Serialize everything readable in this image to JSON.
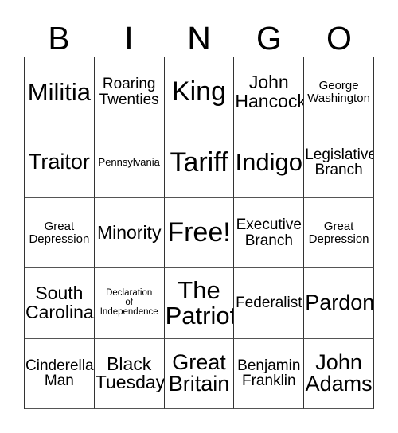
{
  "card": {
    "type": "bingo-card",
    "columns": 5,
    "rows": 5,
    "free_space": "Free!",
    "colors": {
      "background": "#ffffff",
      "text": "#000000",
      "grid_line": "#333333"
    }
  },
  "header": {
    "letters": [
      "B",
      "I",
      "N",
      "G",
      "O"
    ]
  },
  "grid": {
    "rows": [
      {
        "cells": [
          {
            "text": "Militia",
            "size": "xl"
          },
          {
            "text": "Roaring\nTwenties",
            "size": "sm"
          },
          {
            "text": "King",
            "size": "xxl"
          },
          {
            "text": "John\nHancock",
            "size": "md"
          },
          {
            "text": "George\nWashington",
            "size": "xs"
          }
        ]
      },
      {
        "cells": [
          {
            "text": "Traitor",
            "size": "lg"
          },
          {
            "text": "Pennsylvania",
            "size": "xxs"
          },
          {
            "text": "Tariff",
            "size": "xxl"
          },
          {
            "text": "Indigo",
            "size": "xl"
          },
          {
            "text": "Legislative\nBranch",
            "size": "sm"
          }
        ]
      },
      {
        "cells": [
          {
            "text": "Great\nDepression",
            "size": "xs"
          },
          {
            "text": "Minority",
            "size": "md"
          },
          {
            "text": "Free!",
            "size": "xxl"
          },
          {
            "text": "Executive\nBranch",
            "size": "sm"
          },
          {
            "text": "Great\nDepression",
            "size": "xs"
          }
        ]
      },
      {
        "cells": [
          {
            "text": "South\nCarolina",
            "size": "md"
          },
          {
            "text": "Declaration\nof\nIndependence",
            "size": "tiny"
          },
          {
            "text": "The\nPatriot",
            "size": "xl"
          },
          {
            "text": "Federalist",
            "size": "sm"
          },
          {
            "text": "Pardon",
            "size": "lg"
          }
        ]
      },
      {
        "cells": [
          {
            "text": "Cinderella\nMan",
            "size": "sm"
          },
          {
            "text": "Black\nTuesday",
            "size": "md"
          },
          {
            "text": "Great\nBritain",
            "size": "lg"
          },
          {
            "text": "Benjamin\nFranklin",
            "size": "sm"
          },
          {
            "text": "John\nAdams",
            "size": "lg"
          }
        ]
      }
    ]
  }
}
